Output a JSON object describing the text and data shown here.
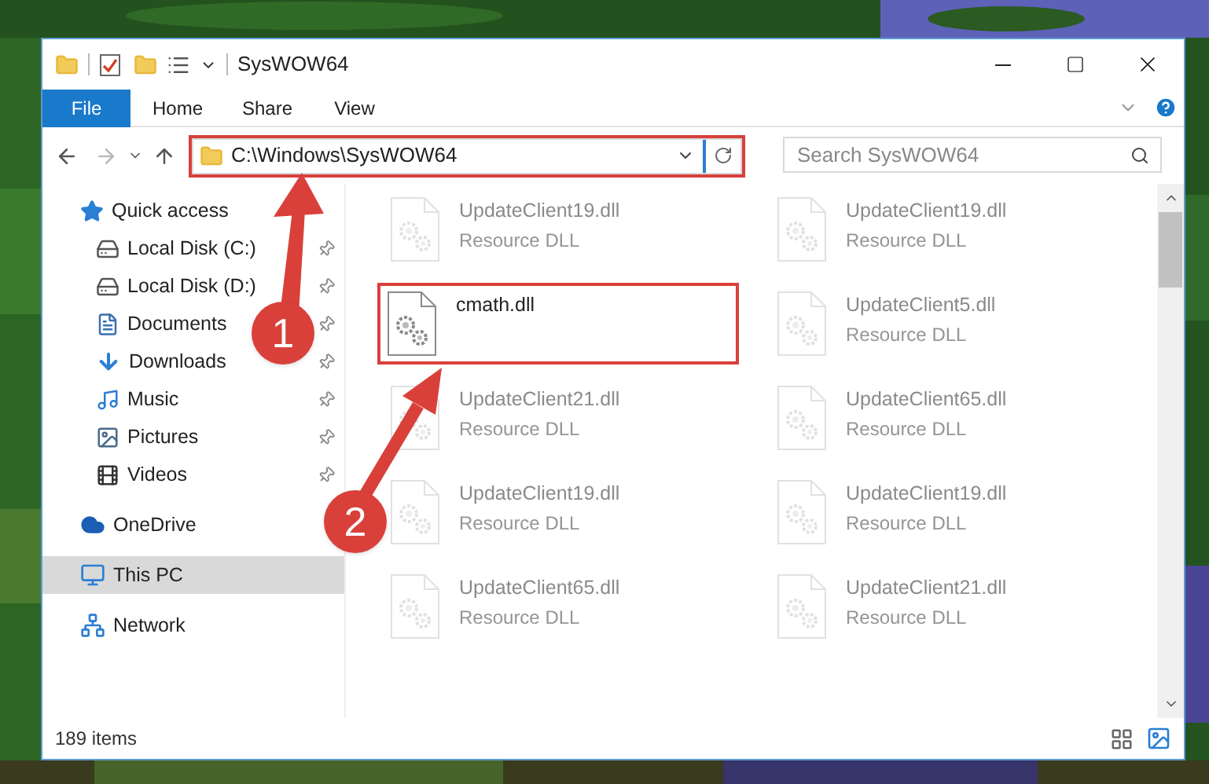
{
  "window": {
    "title": "SysWOW64"
  },
  "ribbon_tabs": [
    {
      "label": "File",
      "selected": true
    },
    {
      "label": "Home",
      "selected": false
    },
    {
      "label": "Share",
      "selected": false
    },
    {
      "label": "View",
      "selected": false
    }
  ],
  "address": {
    "path": "C:\\Windows\\SysWOW64"
  },
  "search": {
    "placeholder": "Search SysWOW64"
  },
  "nav": [
    {
      "label": "Quick access",
      "selected": false,
      "pinned": false,
      "children": [
        {
          "label": "Local Disk (C:)",
          "selected": false,
          "pinned": true
        },
        {
          "label": "Local Disk (D:)",
          "selected": false,
          "pinned": true
        },
        {
          "label": "Documents",
          "selected": false,
          "pinned": true
        },
        {
          "label": "Downloads",
          "selected": false,
          "pinned": true
        },
        {
          "label": "Music",
          "selected": false,
          "pinned": true
        },
        {
          "label": "Pictures",
          "selected": false,
          "pinned": true
        },
        {
          "label": "Videos",
          "selected": false,
          "pinned": true
        }
      ]
    },
    {
      "label": "OneDrive",
      "selected": false,
      "pinned": false
    },
    {
      "label": "This PC",
      "selected": true,
      "pinned": false
    },
    {
      "label": "Network",
      "selected": false,
      "pinned": false
    }
  ],
  "files": [
    {
      "name": "UpdateClient19.dll",
      "type": "Resource DLL",
      "dimmed": true,
      "highlighted": false
    },
    {
      "name": "UpdateClient19.dll",
      "type": "Resource DLL",
      "dimmed": true,
      "highlighted": false
    },
    {
      "name": "cmath.dll",
      "dimmed": false,
      "highlighted": true
    },
    {
      "name": "UpdateClient5.dll",
      "type": "Resource DLL",
      "dimmed": true,
      "highlighted": false
    },
    {
      "name": "UpdateClient21.dll",
      "type": "Resource DLL",
      "dimmed": true,
      "highlighted": false
    },
    {
      "name": "UpdateClient65.dll",
      "type": "Resource DLL",
      "dimmed": true,
      "highlighted": false
    },
    {
      "name": "UpdateClient19.dll",
      "type": "Resource DLL",
      "dimmed": true,
      "highlighted": false
    },
    {
      "name": "UpdateClient19.dll",
      "type": "Resource DLL",
      "dimmed": true,
      "highlighted": false
    },
    {
      "name": "UpdateClient65.dll",
      "type": "Resource DLL",
      "dimmed": true,
      "highlighted": false
    },
    {
      "name": "UpdateClient21.dll",
      "type": "Resource DLL",
      "dimmed": true,
      "highlighted": false
    }
  ],
  "status_bar": {
    "count": "189 items"
  },
  "annotations": [
    {
      "number": "1"
    },
    {
      "number": "2"
    }
  ]
}
